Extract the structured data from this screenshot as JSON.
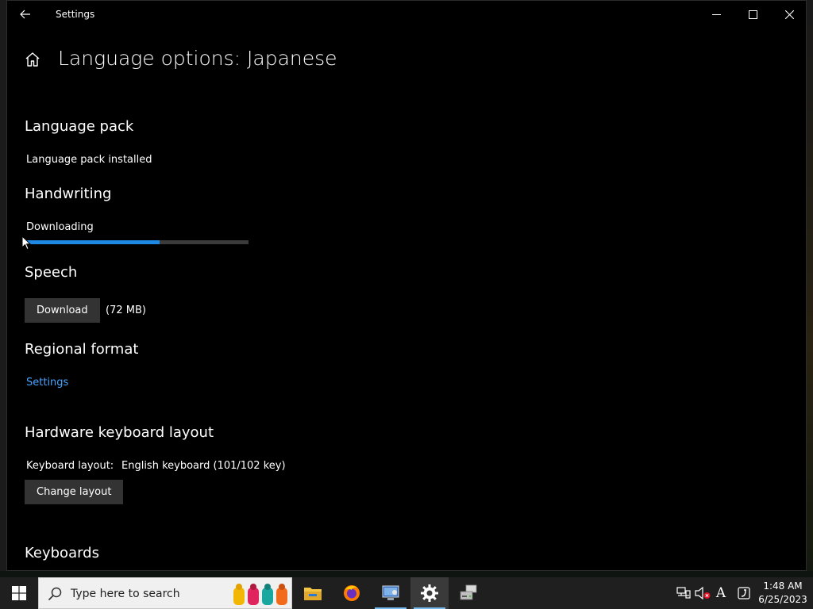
{
  "window": {
    "title": "Settings"
  },
  "page": {
    "title": "Language options: Japanese"
  },
  "sections": {
    "language_pack": {
      "heading": "Language pack",
      "status": "Language pack installed"
    },
    "handwriting": {
      "heading": "Handwriting",
      "status": "Downloading",
      "progress_fraction": 0.6
    },
    "speech": {
      "heading": "Speech",
      "button_label": "Download",
      "size": "(72 MB)"
    },
    "regional_format": {
      "heading": "Regional format",
      "link_label": "Settings"
    },
    "hardware_keyboard": {
      "heading": "Hardware keyboard layout",
      "layout_label": "Keyboard layout:",
      "layout_value": "English keyboard (101/102 key)",
      "button_label": "Change layout"
    },
    "keyboards": {
      "heading": "Keyboards"
    }
  },
  "taskbar": {
    "search_placeholder": "Type here to search",
    "apps": [
      "file-explorer-icon",
      "firefox-icon",
      "control-panel-icon",
      "settings-icon",
      "network-drive-icon"
    ],
    "tray": {
      "ime_indicator": "A",
      "time": "1:48 AM",
      "date": "6/25/2023"
    }
  },
  "colors": {
    "accent": "#1e88e5",
    "link": "#4aa3ff",
    "button_bg": "#333333",
    "window_bg": "#000000",
    "taskbar_bg": "#1f1f1f"
  }
}
